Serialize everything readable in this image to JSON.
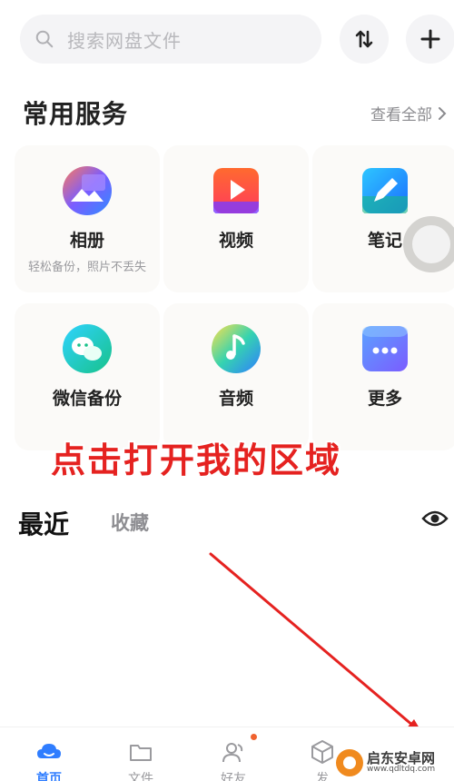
{
  "search": {
    "placeholder": "搜索网盘文件"
  },
  "header": {
    "sort_icon": "sort-arrows-icon",
    "add_icon": "plus-icon"
  },
  "services": {
    "title": "常用服务",
    "see_all": "查看全部",
    "items": [
      {
        "label": "相册",
        "sub": "轻松备份，照片不丢失",
        "icon": "album-icon"
      },
      {
        "label": "视频",
        "sub": "",
        "icon": "video-icon"
      },
      {
        "label": "笔记",
        "sub": "",
        "icon": "note-icon"
      },
      {
        "label": "微信备份",
        "sub": "",
        "icon": "wechat-backup-icon"
      },
      {
        "label": "音频",
        "sub": "",
        "icon": "audio-icon"
      },
      {
        "label": "更多",
        "sub": "",
        "icon": "more-icon"
      }
    ]
  },
  "annotation": {
    "text": "点击打开我的区域",
    "color": "#e52220"
  },
  "recent": {
    "tab_recent": "最近",
    "tab_favorites": "收藏"
  },
  "bottom_nav": {
    "items": [
      {
        "label": "首页",
        "icon": "home-cloud-icon",
        "active": true
      },
      {
        "label": "文件",
        "icon": "folder-icon",
        "active": false
      },
      {
        "label": "好友",
        "icon": "friends-icon",
        "active": false
      },
      {
        "label": "发",
        "icon": "discover-icon",
        "active": false
      }
    ]
  },
  "watermark": {
    "name": "启东安卓网",
    "url": "www.qdltdq.com"
  },
  "colors": {
    "accent": "#2f7dff",
    "annotation": "#e52220",
    "badge": "#f0622f"
  }
}
